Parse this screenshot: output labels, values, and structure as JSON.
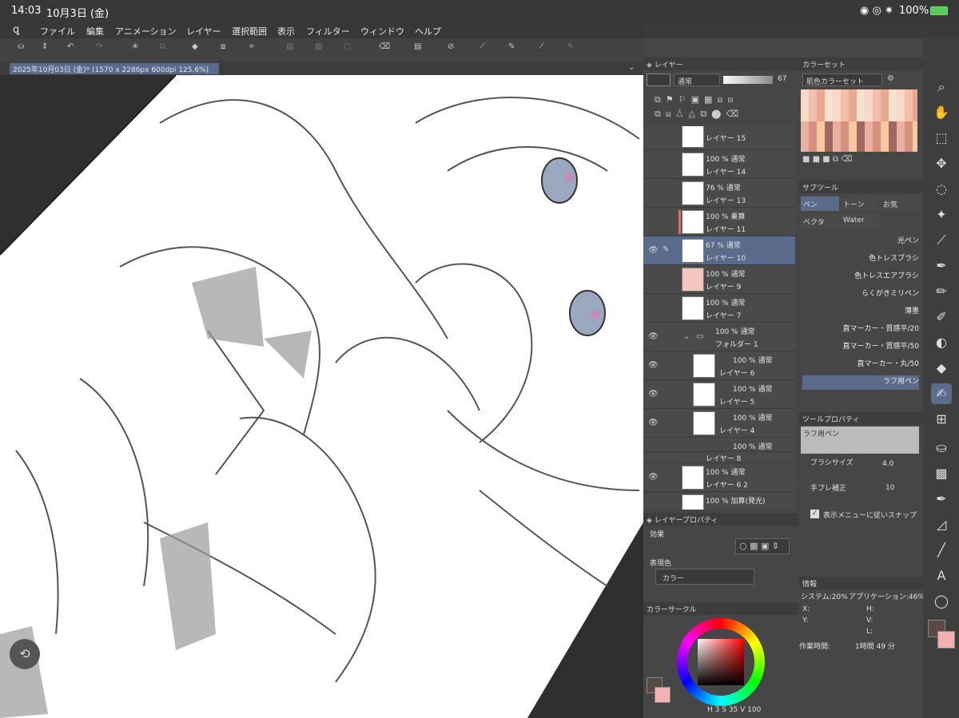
{
  "status": {
    "time": "14:03",
    "date": "10月3日 (金)",
    "battery": "100%"
  },
  "menu": [
    "ファイル",
    "編集",
    "アニメーション",
    "レイヤー",
    "選択範囲",
    "表示",
    "フィルター",
    "ウィンドウ",
    "ヘルプ"
  ],
  "doc_tab": "2025年10月03日 (金)* (1570 x 2286px 600dpi 125.6%)",
  "layer_panel": {
    "title": "レイヤー",
    "blend": "通常",
    "opacity": "67",
    "layers": [
      {
        "pct": "",
        "name": "レイヤー 15"
      },
      {
        "pct": "100 % 通常",
        "name": "レイヤー 14"
      },
      {
        "pct": "76 % 通常",
        "name": "レイヤー 13"
      },
      {
        "pct": "100 % 乗算",
        "name": "レイヤー 11"
      },
      {
        "pct": "67 % 通常",
        "name": "レイヤー 10"
      },
      {
        "pct": "100 % 通常",
        "name": "レイヤー 9"
      },
      {
        "pct": "100 % 通常",
        "name": "レイヤー 7"
      },
      {
        "pct": "100 % 通常",
        "name": "フォルダー 1"
      },
      {
        "pct": "100 % 通常",
        "name": "レイヤー 6"
      },
      {
        "pct": "100 % 通常",
        "name": "レイヤー 5"
      },
      {
        "pct": "100 % 通常",
        "name": "レイヤー 4"
      },
      {
        "pct": "100 % 通常",
        "name": ""
      },
      {
        "pct": "",
        "name": "レイヤー 8"
      },
      {
        "pct": "100 % 通常",
        "name": "レイヤー 6 2"
      },
      {
        "pct": "100 % 加算(発光)",
        "name": ""
      }
    ]
  },
  "layer_prop": {
    "title": "レイヤープロパティ",
    "effect": "効果",
    "express": "表現色",
    "color_mode": "カラー"
  },
  "color_circle": {
    "title": "カラーサークル",
    "h": "3",
    "s": "35",
    "v": "100"
  },
  "color_set": {
    "title": "カラーセット",
    "name": "肌色カラーセット"
  },
  "sub_tool": {
    "title": "サブツール",
    "tabs": [
      "ペン",
      "トーン",
      "お気",
      "ベクタ",
      "Water"
    ],
    "brushes": [
      "光ペン",
      "色トレスブラシ",
      "色トレスエアブラシ",
      "らくがきミリペン",
      "薄墨",
      "直マーカー・質感平/20",
      "直マーカー・質感平/50",
      "直マーカー・丸/50",
      "ラフ用ペン"
    ]
  },
  "tool_prop": {
    "title": "ツールプロパティ",
    "tool": "ラフ用ペン",
    "brush_size_label": "ブラシサイズ",
    "brush_size": "4.0",
    "stab_label": "手ブレ補正",
    "stab": "10",
    "snap_label": "表示メニューに従いスナップ"
  },
  "info": {
    "title": "情報",
    "system": "システム:20%",
    "app": "アプリケーション:46%",
    "x": "X:",
    "y": "Y:",
    "h": "H:",
    "v": "V:",
    "l": "L:",
    "time_label": "作業時間:",
    "time": "1時間 49 分"
  }
}
